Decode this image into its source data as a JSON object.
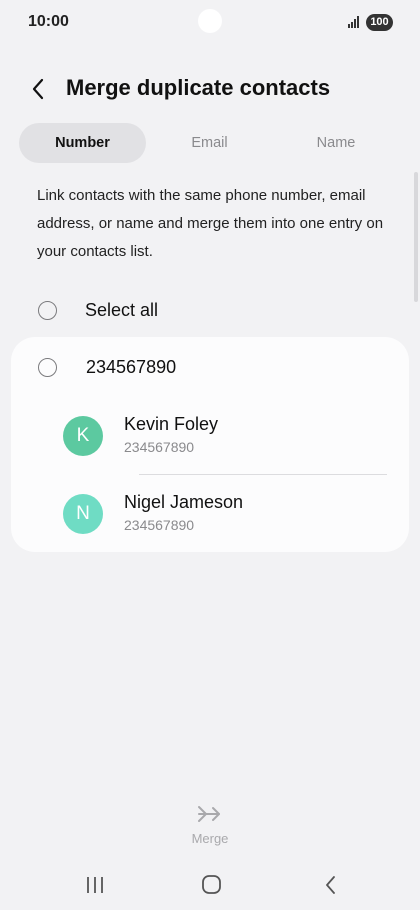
{
  "status_bar": {
    "time": "10:00",
    "battery": "100"
  },
  "header": {
    "title": "Merge duplicate contacts"
  },
  "tabs": [
    {
      "label": "Number",
      "active": true
    },
    {
      "label": "Email",
      "active": false
    },
    {
      "label": "Name",
      "active": false
    }
  ],
  "description": "Link contacts with the same phone number, email address, or name and merge them into one entry on your contacts list.",
  "select_all": {
    "label": "Select all"
  },
  "group": {
    "number": "234567890",
    "contacts": [
      {
        "initial": "K",
        "name": "Kevin Foley",
        "phone": "234567890",
        "avatar_color": "#5cc9a0"
      },
      {
        "initial": "N",
        "name": "Nigel Jameson",
        "phone": "234567890",
        "avatar_color": "#6fdcc4"
      }
    ]
  },
  "merge": {
    "label": "Merge",
    "enabled": false
  },
  "icons": {
    "back": "chevron-left-icon",
    "merge": "merge-arrows-icon",
    "nav_recent": "recent-apps-icon",
    "nav_home": "home-icon",
    "nav_back": "back-icon"
  },
  "colors": {
    "background": "#f2f2f4",
    "card": "#fcfcfd",
    "tab_active": "#e1e1e4",
    "muted_text": "#8a8a8d"
  }
}
